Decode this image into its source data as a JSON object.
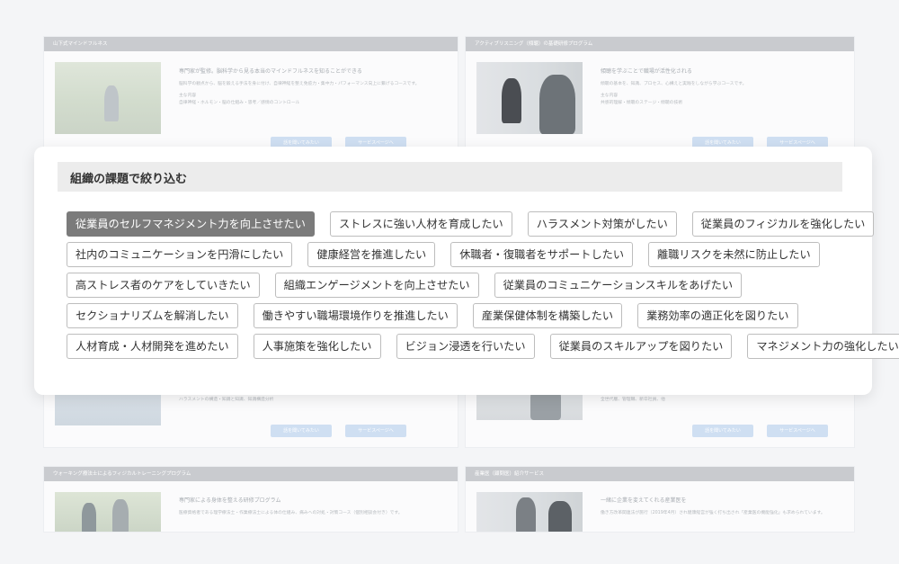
{
  "background_cards": [
    {
      "header": "山下式マインドフルネス",
      "lead": "専門家が監修。脳科学から見る本当のマインドフルネスを知ることができる",
      "body": "脳科学の観点から、脳を鍛える手法を身に付け、自律神経を整え免疫力・集中力・パフォーマンス向上に繋げるコースです。",
      "topics_label": "主な内容",
      "topics": "自律神経・ホルモン・脳の仕組み・思考／感情のコントロール",
      "button_1": "話を聞いてみたい",
      "button_2": "サービスページへ"
    },
    {
      "header": "アクティブリスニング（傾聴）の基礎研修プログラム",
      "lead": "傾聴を学ぶことで職場が活性化される",
      "body": "傾聴の基本を、知識、プロセス、心構えと実践をしながら学ぶコースです。",
      "topics_label": "主な内容",
      "topics": "共感的理解・傾聴のステージ・傾聴の技術",
      "button_1": "話を聞いてみたい",
      "button_2": "サービスページへ"
    },
    {
      "body": "ハラスメントの構造・知識と知識、知識構造分析",
      "button_1": "話を聞いてみたい",
      "button_2": "サービスページへ"
    },
    {
      "body": "全世代層、管理職、新卒社員、他",
      "button_1": "話を聞いてみたい",
      "button_2": "サービスページへ"
    },
    {
      "header": "ウォーキング療法士によるフィジカルトレーニングプログラム",
      "lead": "専門家による身体を整える研修プログラム",
      "body": "医療資格者である理学療法士・作業療法士による体の仕組み、痛みへの対処・対策コース（個別相談会付き）です。"
    },
    {
      "header": "産業医（顧問医）紹介サービス",
      "lead": "一緒に企業を変えてくれる産業医を",
      "body": "働き方改革関連法が施行（2019年4月）され健康経営が強く打ち出され「産業医の機能強化」も求められています。"
    }
  ],
  "filter_panel": {
    "title": "組織の課題で絞り込む",
    "rows": [
      [
        {
          "label": "従業員のセルフマネジメント力を向上させたい",
          "selected": true
        },
        {
          "label": "ストレスに強い人材を育成したい",
          "selected": false
        },
        {
          "label": "ハラスメント対策がしたい",
          "selected": false
        },
        {
          "label": "従業員のフィジカルを強化したい",
          "selected": false
        }
      ],
      [
        {
          "label": "社内のコミュニケーションを円滑にしたい",
          "selected": false
        },
        {
          "label": "健康経営を推進したい",
          "selected": false
        },
        {
          "label": "休職者・復職者をサポートしたい",
          "selected": false
        },
        {
          "label": "離職リスクを未然に防止したい",
          "selected": false
        }
      ],
      [
        {
          "label": "高ストレス者のケアをしていきたい",
          "selected": false
        },
        {
          "label": "組織エンゲージメントを向上させたい",
          "selected": false
        },
        {
          "label": "従業員のコミュニケーションスキルをあげたい",
          "selected": false
        }
      ],
      [
        {
          "label": "セクショナリズムを解消したい",
          "selected": false
        },
        {
          "label": "働きやすい職場環境作りを推進したい",
          "selected": false
        },
        {
          "label": "産業保健体制を構築したい",
          "selected": false
        },
        {
          "label": "業務効率の適正化を図りたい",
          "selected": false
        }
      ],
      [
        {
          "label": "人材育成・人材開発を進めたい",
          "selected": false
        },
        {
          "label": "人事施策を強化したい",
          "selected": false
        },
        {
          "label": "ビジョン浸透を行いたい",
          "selected": false
        },
        {
          "label": "従業員のスキルアップを図りたい",
          "selected": false
        },
        {
          "label": "マネジメント力の強化したい",
          "selected": false
        }
      ]
    ]
  },
  "colors": {
    "selected_chip": "#7b7b7b",
    "chip_border": "#bdbdbd",
    "card_header": "#c9cbcf",
    "card_button": "#cfdff2"
  }
}
